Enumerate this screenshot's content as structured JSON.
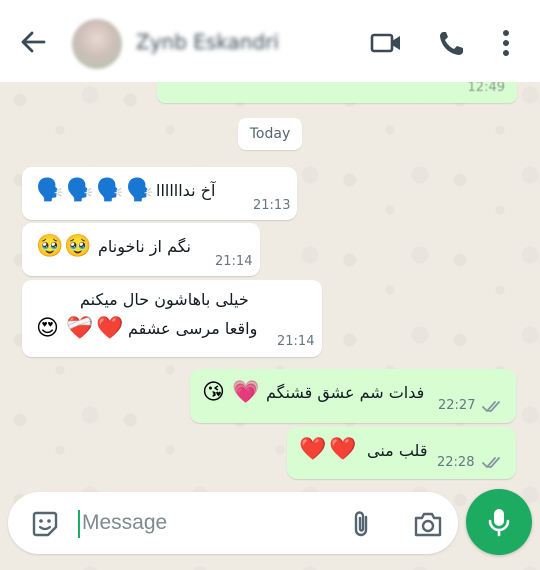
{
  "header": {
    "contact_name": "Zynb Eskandri",
    "icons": [
      "back-arrow-icon",
      "avatar",
      "video-call-icon",
      "voice-call-icon",
      "more-options-icon"
    ]
  },
  "top_message": {
    "time": "12:49"
  },
  "date_divider": "Today",
  "messages": [
    {
      "direction": "in",
      "text": "آخ نداااااا",
      "emoji": [
        "🗣️",
        "🗣️",
        "🗣️",
        "🗣️"
      ],
      "time": "21:13"
    },
    {
      "direction": "in",
      "text": "نگم از ناخونام",
      "emoji": [
        "🥹",
        "🥹"
      ],
      "time": "21:14"
    },
    {
      "direction": "in",
      "line1": "خیلی باهاشون حال میکنم",
      "line2": "واقعا مرسی عشقم",
      "emoji": [
        "😍",
        "❤️‍🩹",
        "❤️"
      ],
      "time": "21:14"
    },
    {
      "direction": "out",
      "text": "فدات شم عشق قشنگم",
      "emoji": [
        "😘",
        "💗"
      ],
      "time": "22:27",
      "status": "read"
    },
    {
      "direction": "out",
      "text": "قلب منی",
      "emoji": [
        "❤️",
        "❤️"
      ],
      "time": "22:28",
      "status": "read"
    }
  ],
  "composer": {
    "placeholder": "Message",
    "icons": [
      "sticker-icon",
      "attach-icon",
      "camera-icon",
      "mic-icon"
    ]
  },
  "colors": {
    "accent": "#1daa61",
    "outgoing_bubble": "#d9fdd3",
    "incoming_bubble": "#ffffff",
    "wallpaper": "#efeae2",
    "read_ticks": "#8696a0"
  }
}
